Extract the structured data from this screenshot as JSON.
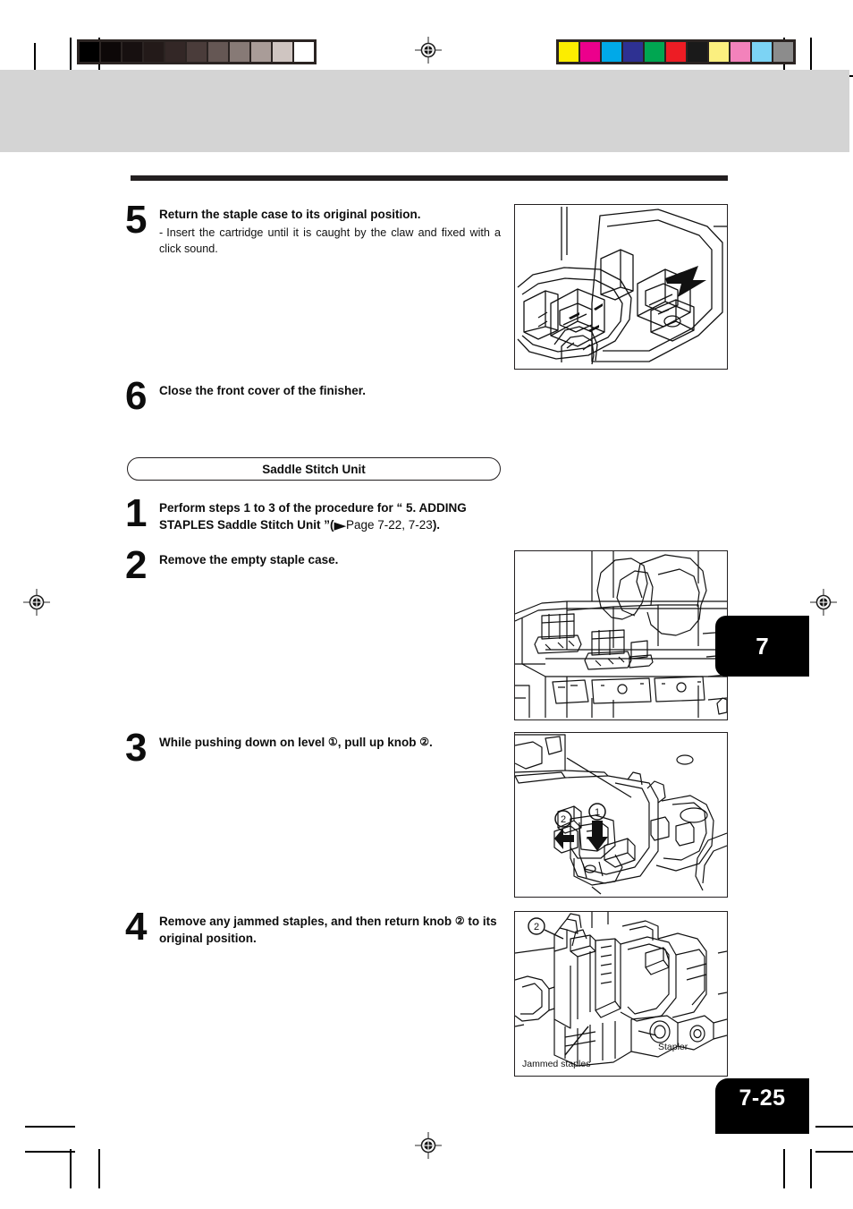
{
  "page": {
    "folio": "7-25",
    "chapter_tab": "7"
  },
  "section": {
    "pill_label": "Saddle Stitch Unit"
  },
  "steps": [
    {
      "number": "5",
      "title": "Return the staple case to its original position.",
      "dash": "-",
      "sub": "Insert the cartridge until it is caught by the claw and fixed with a click sound."
    },
    {
      "number": "6",
      "title": "Close the front cover of the finisher."
    },
    {
      "number": "1",
      "title_part1": "Perform steps 1 to 3 of the procedure for “ 5. ADDING STAPLES Saddle Stitch Unit ”(",
      "xref_arrow": "▶",
      "xref_text": "Page 7-22, 7-23",
      "title_part2": ")."
    },
    {
      "number": "2",
      "title": "Remove the empty staple case."
    },
    {
      "number": "3",
      "title_part1": "While pushing down on level ",
      "callout1": "①",
      "title_part2": ", pull up knob ",
      "callout2": "②",
      "title_part3": "."
    },
    {
      "number": "4",
      "title_part1": "Remove any jammed staples, and then return knob ",
      "callout1": "②",
      "title_part2": " to its original position."
    }
  ],
  "figures": [
    {
      "name": "staple-case-insert",
      "caption": "",
      "callouts": []
    },
    {
      "name": "remove-empty-staple-case",
      "caption": "",
      "callouts": []
    },
    {
      "name": "push-level-pull-knob",
      "caption": "",
      "callouts": [
        "1",
        "2"
      ]
    },
    {
      "name": "jammed-staples-stapler",
      "callouts": [
        "2"
      ],
      "label_stapler": "Stapler",
      "label_jammed": "Jammed staples"
    }
  ],
  "prepress": {
    "grayscale_patches": [
      "#000000",
      "#0d0808",
      "#171010",
      "#231a19",
      "#332726",
      "#4a3c3a",
      "#655754",
      "#877a76",
      "#a99c98",
      "#cfc5c1",
      "#ffffff"
    ],
    "color_patches": [
      "#fced00",
      "#ec008c",
      "#00a9e8",
      "#2e3192",
      "#00a651",
      "#ed1c24",
      "#1a1a1a",
      "#fbef7f",
      "#f382bb",
      "#7cd3f4",
      "#8c8c8c"
    ]
  }
}
